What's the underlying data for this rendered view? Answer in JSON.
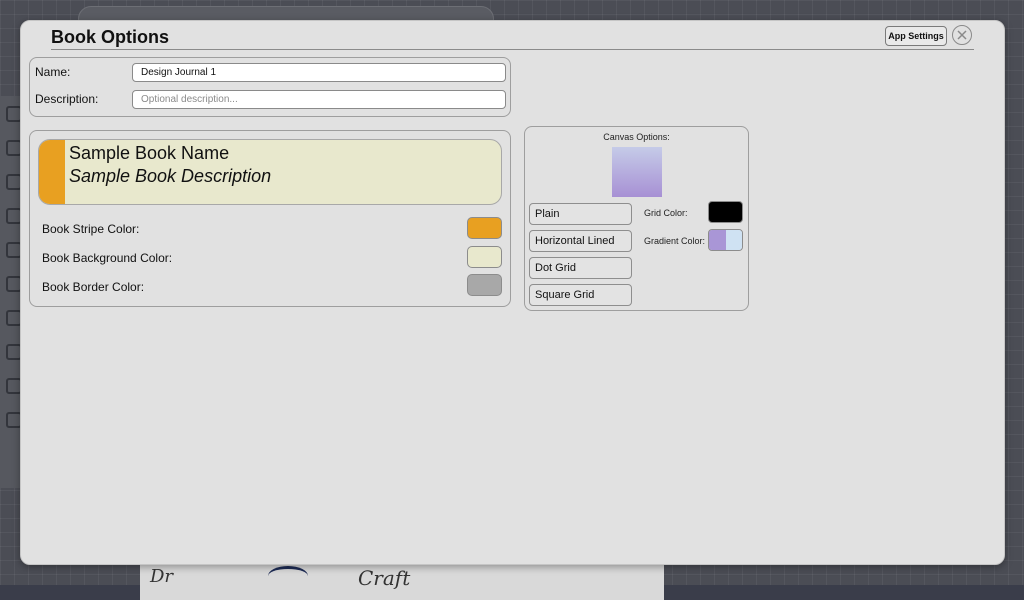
{
  "dialog": {
    "title": "Book Options",
    "app_settings_label": "App Settings",
    "close_icon": "close-circle-icon"
  },
  "fields": {
    "name_label": "Name:",
    "name_value": "Design Journal 1",
    "description_label": "Description:",
    "description_placeholder": "Optional description..."
  },
  "book": {
    "sample_name": "Sample Book Name",
    "sample_description": "Sample Book Description",
    "stripe_label": "Book Stripe Color:",
    "background_label": "Book Background Color:",
    "border_label": "Book Border Color:",
    "stripe_color": "#e8a021",
    "background_color": "#e8e8cd",
    "border_color": "#a8a8a8"
  },
  "canvas": {
    "title": "Canvas Options:",
    "options": [
      "Plain",
      "Horizontal Lined",
      "Dot Grid",
      "Square Grid"
    ],
    "grid_color_label": "Grid Color:",
    "gradient_color_label": "Gradient Color:",
    "grid_color": "#000000",
    "gradient_start": "#a996d6",
    "gradient_end": "#cfe2f3",
    "preview_top": "#c5cbe8",
    "preview_bottom": "#a790d4"
  },
  "background_canvas": {
    "text_left": "Dr",
    "text_right": "Craft"
  }
}
